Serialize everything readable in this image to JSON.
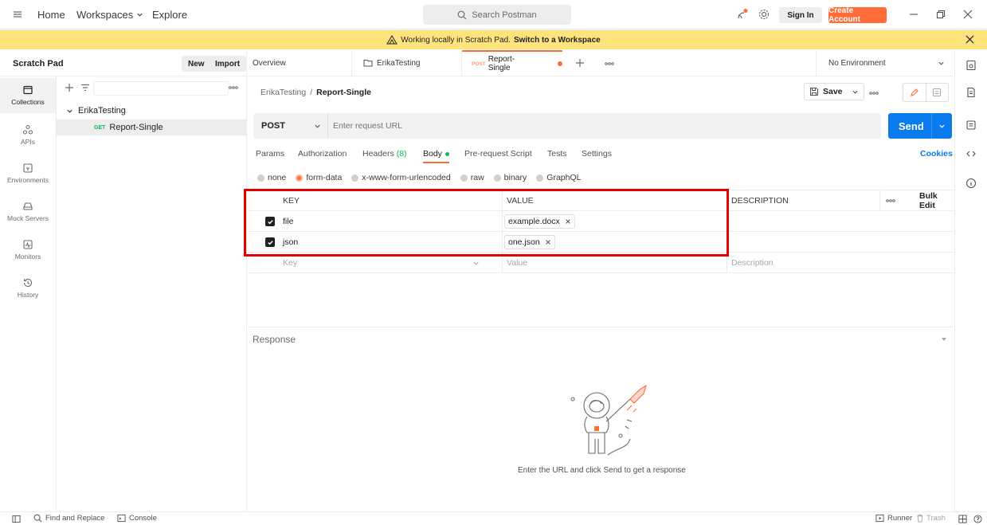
{
  "topbar": {
    "nav": [
      "Home",
      "Workspaces",
      "Explore"
    ],
    "search_placeholder": "Search Postman",
    "sign_in": "Sign In",
    "create_account": "Create Account"
  },
  "banner": {
    "text": "Working locally in Scratch Pad.",
    "link": "Switch to a Workspace"
  },
  "sidebar": {
    "title": "Scratch Pad",
    "new_label": "New",
    "import_label": "Import",
    "rail": [
      "Collections",
      "APIs",
      "Environments",
      "Mock Servers",
      "Monitors",
      "History"
    ],
    "collection_name": "ErikaTesting",
    "request_method": "GET",
    "request_name": "Report-Single"
  },
  "tabs": {
    "overview": "Overview",
    "collection": "ErikaTesting",
    "active_method": "POST",
    "active_name": "Report-Single",
    "environment": "No Environment"
  },
  "request": {
    "breadcrumb_parent": "ErikaTesting",
    "breadcrumb_sep": "/",
    "breadcrumb_current": "Report-Single",
    "save_label": "Save",
    "method": "POST",
    "url_placeholder": "Enter request URL",
    "send_label": "Send",
    "subtabs": {
      "params": "Params",
      "authorization": "Authorization",
      "headers": "Headers",
      "headers_count": "(8)",
      "body": "Body",
      "prerequest": "Pre-request Script",
      "tests": "Tests",
      "settings": "Settings",
      "cookies": "Cookies"
    },
    "body_types": [
      "none",
      "form-data",
      "x-www-form-urlencoded",
      "raw",
      "binary",
      "GraphQL"
    ],
    "selected_body_type": "form-data"
  },
  "table": {
    "headers": {
      "key": "KEY",
      "value": "VALUE",
      "description": "DESCRIPTION",
      "bulk_edit": "Bulk Edit"
    },
    "rows": [
      {
        "key": "file",
        "value": "example.docx",
        "checked": true
      },
      {
        "key": "json",
        "value": "one.json",
        "checked": true
      }
    ],
    "placeholder": {
      "key": "Key",
      "value": "Value",
      "description": "Description"
    }
  },
  "response": {
    "title": "Response",
    "empty_message": "Enter the URL and click Send to get a response"
  },
  "statusbar": {
    "find_replace": "Find and Replace",
    "console": "Console",
    "runner": "Runner",
    "trash": "Trash"
  },
  "colors": {
    "accent": "#ff6c37",
    "send": "#097bed",
    "banner": "#ffe47e",
    "highlight": "#e10000"
  }
}
